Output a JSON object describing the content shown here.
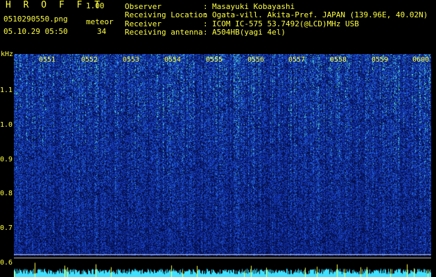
{
  "header": {
    "app_name": "H R O F F T",
    "version": "1.00",
    "filename": "0510290550.png",
    "meteor_label": "meteor",
    "datetime": "05.10.29 05:50",
    "meteor_count": "34"
  },
  "station_info": {
    "rows": [
      {
        "label": "Observer",
        "sep": ":",
        "value": "Masayuki Kobayashi"
      },
      {
        "label": "Receiving Location",
        "sep": ":",
        "value": "Ogata-vill. Akita-Pref. JAPAN (139.96E, 40.02N)"
      },
      {
        "label": "Receiver",
        "sep": ":",
        "value": "ICOM IC-575 53.7492(@LCD)MHz USB"
      },
      {
        "label": "Receiving antenna",
        "sep": ":",
        "value": "A504HB(yagi 4el)"
      }
    ]
  },
  "spectrogram": {
    "y_unit": "kHz",
    "y_ticks": [
      "1.1",
      "1.0",
      "0.9",
      "0.8",
      "0.7",
      "0.6"
    ],
    "time_ticks": [
      "0551",
      "0552",
      "0553",
      "0554",
      "0555",
      "0556",
      "0557",
      "0558",
      "0559",
      "0600"
    ],
    "colors": {
      "background": "#0a1a6a",
      "noise": "#2a5cd8",
      "echo": "#7fffd0",
      "baseline": "#40e0ff",
      "marker": "#ffff40"
    }
  }
}
